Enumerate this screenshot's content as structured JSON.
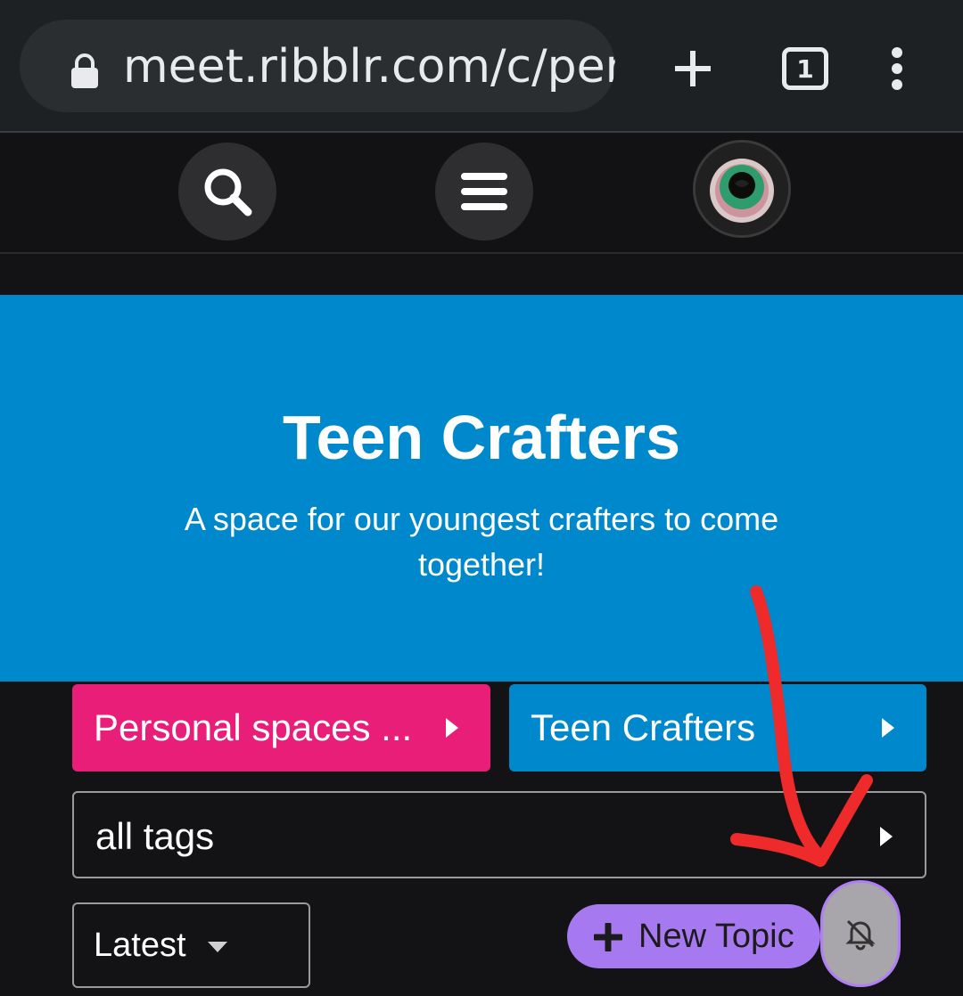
{
  "browser": {
    "url": "meet.ribblr.com/c/pers",
    "tab_count": "1",
    "icons": [
      "lock-icon",
      "plus-icon",
      "tabs-icon",
      "more-vert-icon"
    ]
  },
  "header": {
    "icons": [
      "search-icon",
      "hamburger-icon",
      "avatar"
    ]
  },
  "banner": {
    "title": "Teen Crafters",
    "description": "A space for our youngest crafters to come together!",
    "color": "#0088cc"
  },
  "breadcrumbs": {
    "parent": {
      "label": "Personal spaces ...",
      "color": "#e91e78"
    },
    "category": {
      "label": "Teen Crafters",
      "color": "#0088cc"
    },
    "tags": {
      "label": "all tags"
    }
  },
  "controls": {
    "sort_label": "Latest",
    "new_topic_label": "New Topic",
    "new_topic_color": "#a779f0",
    "notification_icon": "bell-slash-icon"
  },
  "annotation": {
    "color": "#ee2a2a",
    "shape": "red-arrow"
  }
}
